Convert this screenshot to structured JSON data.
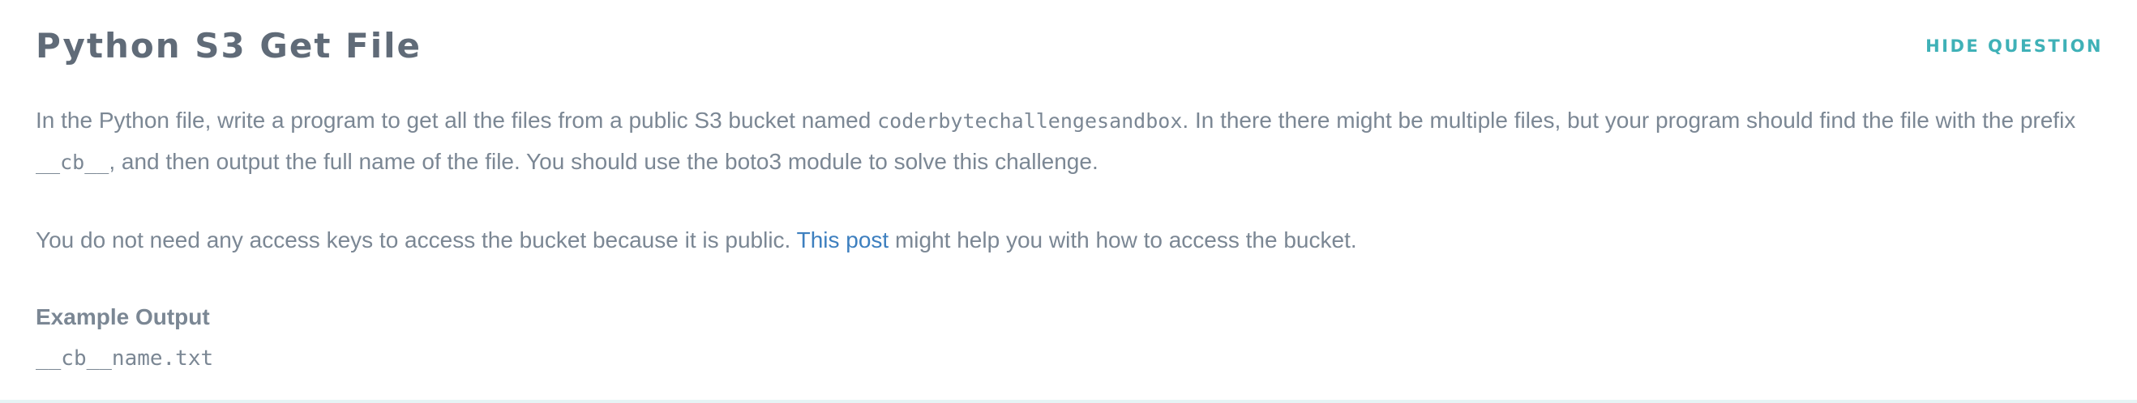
{
  "question": {
    "title": "Python S3 Get File",
    "hide_label": "HIDE QUESTION",
    "paragraph1": {
      "text_a": "In the Python file, write a program to get all the files from a public S3 bucket named ",
      "bucket_name": "coderbytechallengesandbox",
      "text_b": ". In there there might be multiple files, but your program should find the file with the prefix ",
      "prefix": "__cb__",
      "text_c": ", and then output the full name of the file. You should use the boto3 module to solve this challenge."
    },
    "paragraph2": {
      "text_a": "You do not need any access keys to access the bucket because it is public. ",
      "link_text": "This post",
      "text_b": " might help you with how to access the bucket."
    },
    "example": {
      "label": "Example Output",
      "output": "__cb__name.txt"
    }
  },
  "colors": {
    "title": "#606b78",
    "body_text": "#7b8794",
    "accent": "#3fb1b7",
    "link": "#3d7fbf"
  }
}
